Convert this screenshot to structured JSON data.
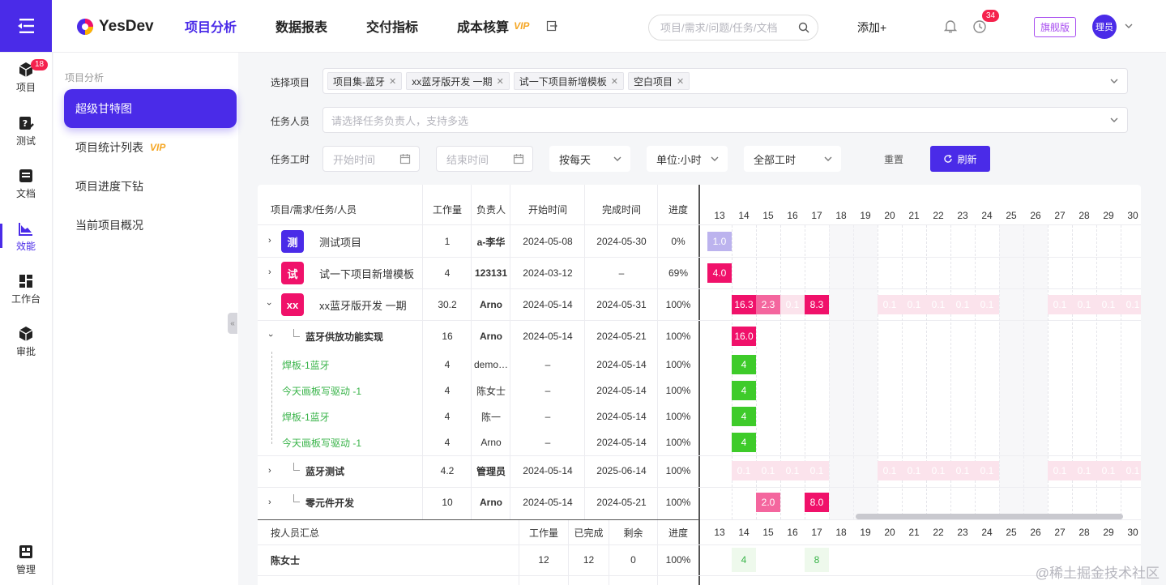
{
  "brand": {
    "name": "YesDev"
  },
  "nav": [
    {
      "label": "项目分析",
      "active": true
    },
    {
      "label": "数据报表"
    },
    {
      "label": "交付指标"
    },
    {
      "label": "成本核算",
      "vip": "VIP"
    }
  ],
  "search": {
    "placeholder": "项目/需求/问题/任务/文档"
  },
  "header": {
    "add_label": "添加+",
    "clock_badge": "34",
    "edition": "旗舰版",
    "avatar": "理员"
  },
  "rail": [
    {
      "label": "项目",
      "badge": "18"
    },
    {
      "label": "测试"
    },
    {
      "label": "文档"
    },
    {
      "label": "效能",
      "active": true
    },
    {
      "label": "工作台"
    },
    {
      "label": "审批"
    },
    {
      "label": "管理"
    }
  ],
  "subnav": {
    "title": "项目分析",
    "items": [
      {
        "label": "超级甘特图",
        "active": true
      },
      {
        "label": "项目统计列表",
        "vip": "VIP"
      },
      {
        "label": "项目进度下钻"
      },
      {
        "label": "当前项目概况"
      }
    ]
  },
  "filters": {
    "project_label": "选择项目",
    "project_tags": [
      "项目集-蓝牙",
      "xx蓝牙版开发 一期",
      "试一下项目新增模板",
      "空白项目"
    ],
    "person_label": "任务人员",
    "person_placeholder": "请选择任务负责人，支持多选",
    "hours_label": "任务工时",
    "start_placeholder": "开始时间",
    "end_placeholder": "结束时间",
    "granularity": "按每天",
    "unit": "单位:小时",
    "hours_type": "全部工时",
    "reset": "重置",
    "refresh": "刷新"
  },
  "table": {
    "headers": {
      "name": "项目/需求/任务/人员",
      "workload": "工作量",
      "owner": "负责人",
      "start": "开始时间",
      "end": "完成时间",
      "progress": "进度"
    },
    "rows": [
      {
        "icon": "测",
        "name": "测试项目",
        "workload": "1",
        "owner": "a-李华",
        "start": "2024-05-08",
        "end": "2024-05-30",
        "progress": "0%"
      },
      {
        "icon": "试",
        "name": "试一下项目新增模板",
        "workload": "4",
        "owner": "123131",
        "start": "2024-03-12",
        "end": "–",
        "progress": "69%"
      },
      {
        "icon": "xx",
        "name": "xx蓝牙版开发 一期",
        "workload": "30.2",
        "owner": "Arno",
        "start": "2024-05-14",
        "end": "2024-05-31",
        "progress": "100%"
      },
      {
        "name": "蓝牙供放功能实现",
        "workload": "16",
        "owner": "Arno",
        "start": "2024-05-14",
        "end": "2024-05-21",
        "progress": "100%"
      },
      {
        "name": "焊板-1蓝牙",
        "workload": "4",
        "owner": "demo…",
        "start": "–",
        "end": "2024-05-14",
        "progress": "100%"
      },
      {
        "name": "今天画板写驱动 -1",
        "workload": "4",
        "owner": "陈女士",
        "start": "–",
        "end": "2024-05-14",
        "progress": "100%"
      },
      {
        "name": "焊板-1蓝牙",
        "workload": "4",
        "owner": "陈一",
        "start": "–",
        "end": "2024-05-14",
        "progress": "100%"
      },
      {
        "name": "今天画板写驱动 -1",
        "workload": "4",
        "owner": "Arno",
        "start": "–",
        "end": "2024-05-14",
        "progress": "100%"
      },
      {
        "name": "蓝牙测试",
        "workload": "4.2",
        "owner": "管理员",
        "start": "2024-05-14",
        "end": "2025-06-14",
        "progress": "100%"
      },
      {
        "name": "零元件开发",
        "workload": "10",
        "owner": "Arno",
        "start": "2024-05-14",
        "end": "2024-05-21",
        "progress": "100%"
      }
    ],
    "bars": {
      "r0": [
        "1.0"
      ],
      "r1": [
        "4.0"
      ],
      "r2": [
        "16.3",
        "2.3",
        "8.3"
      ],
      "r3": [
        "16.0"
      ],
      "r4": [
        "4"
      ],
      "r5": [
        "4"
      ],
      "r6": [
        "4"
      ],
      "r7": [
        "4"
      ],
      "r9": [
        "2.0",
        "8.0"
      ]
    },
    "faint_value": "0.1"
  },
  "days": [
    "13",
    "14",
    "15",
    "16",
    "17",
    "18",
    "19",
    "20",
    "21",
    "22",
    "23",
    "24",
    "25",
    "26",
    "27",
    "28",
    "29",
    "30"
  ],
  "summary": {
    "headers": {
      "name": "按人员汇总",
      "workload": "工作量",
      "done": "已完成",
      "remaining": "剩余",
      "progress": "进度"
    },
    "rows": [
      {
        "name": "陈女士",
        "workload": "12",
        "done": "12",
        "remaining": "0",
        "progress": "100%",
        "cells": [
          "4",
          "8"
        ]
      }
    ]
  },
  "watermark": "@稀土掘金技术社区",
  "colors": {
    "accent": "#4a2be8",
    "pink": "#f0116a",
    "light_pink": "#f4669e",
    "green": "#3ecb2a",
    "lavender": "#bcb3ee"
  }
}
